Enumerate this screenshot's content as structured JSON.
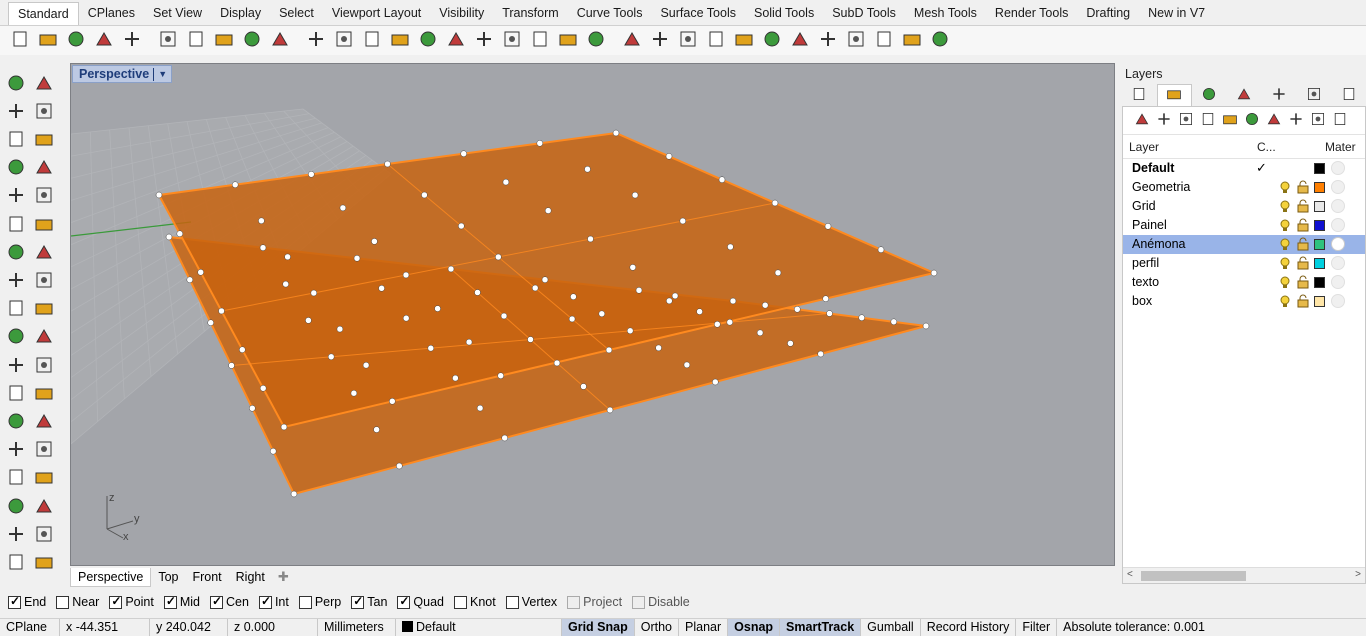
{
  "tabs": [
    "Standard",
    "CPlanes",
    "Set View",
    "Display",
    "Select",
    "Viewport Layout",
    "Visibility",
    "Transform",
    "Curve Tools",
    "Surface Tools",
    "Solid Tools",
    "SubD Tools",
    "Mesh Tools",
    "Render Tools",
    "Drafting",
    "New in V7"
  ],
  "active_tab": "Standard",
  "toolbar_icons": [
    "new-file-icon",
    "open-icon",
    "save-icon",
    "print-icon",
    "import-icon",
    "cut-icon",
    "copy-icon",
    "paste-icon",
    "undo-icon",
    "pan-icon",
    "rotate-view-icon",
    "zoom-icon",
    "zoom-window-icon",
    "zoom-extents-icon",
    "zoom-selected-icon",
    "rotate-camera-icon",
    "viewport-layout-icon",
    "car-icon",
    "cplane-icon",
    "grid-icon",
    "points-icon",
    "light-icon",
    "lock-icon",
    "layer-icon",
    "color-wheel-icon",
    "material-icon",
    "render-sphere-icon",
    "sphere-icon",
    "analysis-icon",
    "options-icon",
    "dimension-icon",
    "render-icon",
    "help-icon"
  ],
  "viewport": {
    "title": "Perspective",
    "axis_labels": {
      "z": "z",
      "y": "y",
      "x": "x"
    },
    "colors": {
      "background": "#a3a5aa",
      "surface": "#c8630f",
      "edge": "#ff8a1f",
      "grid": "#b2b4b8"
    }
  },
  "view_tabs": [
    "Perspective",
    "Top",
    "Front",
    "Right"
  ],
  "active_view_tab": "Perspective",
  "layers_panel": {
    "title": "Layers",
    "columns": {
      "layer": "Layer",
      "current": "C...",
      "material": "Mater"
    },
    "layers": [
      {
        "name": "Default",
        "current": true,
        "color": "#000000",
        "bold": true
      },
      {
        "name": "Geometria",
        "color": "#ff7f00"
      },
      {
        "name": "Grid",
        "color": "#e8e8e8"
      },
      {
        "name": "Painel",
        "color": "#1010d0"
      },
      {
        "name": "Anémona",
        "color": "#2ec27e",
        "selected": true
      },
      {
        "name": "perfil",
        "color": "#00d0e0"
      },
      {
        "name": "texto",
        "color": "#000000"
      },
      {
        "name": "box",
        "color": "#ffe6a8"
      }
    ]
  },
  "osnaps": [
    {
      "label": "End",
      "checked": true
    },
    {
      "label": "Near",
      "checked": false
    },
    {
      "label": "Point",
      "checked": true
    },
    {
      "label": "Mid",
      "checked": true
    },
    {
      "label": "Cen",
      "checked": true
    },
    {
      "label": "Int",
      "checked": true
    },
    {
      "label": "Perp",
      "checked": false
    },
    {
      "label": "Tan",
      "checked": true
    },
    {
      "label": "Quad",
      "checked": true
    },
    {
      "label": "Knot",
      "checked": false
    },
    {
      "label": "Vertex",
      "checked": false
    },
    {
      "label": "Project",
      "checked": false,
      "disabled": true
    },
    {
      "label": "Disable",
      "checked": false,
      "disabled": true
    }
  ],
  "status": {
    "cplane": "CPlane",
    "x": "x -44.351",
    "y": "y 240.042",
    "z": "z 0.000",
    "units": "Millimeters",
    "layer": "Default",
    "toggles": [
      {
        "label": "Grid Snap",
        "on": true
      },
      {
        "label": "Ortho",
        "on": false
      },
      {
        "label": "Planar",
        "on": false
      },
      {
        "label": "Osnap",
        "on": true
      },
      {
        "label": "SmartTrack",
        "on": true
      },
      {
        "label": "Gumball",
        "on": false
      },
      {
        "label": "Record History",
        "on": false
      },
      {
        "label": "Filter",
        "on": false
      }
    ],
    "tolerance": "Absolute tolerance: 0.001"
  }
}
